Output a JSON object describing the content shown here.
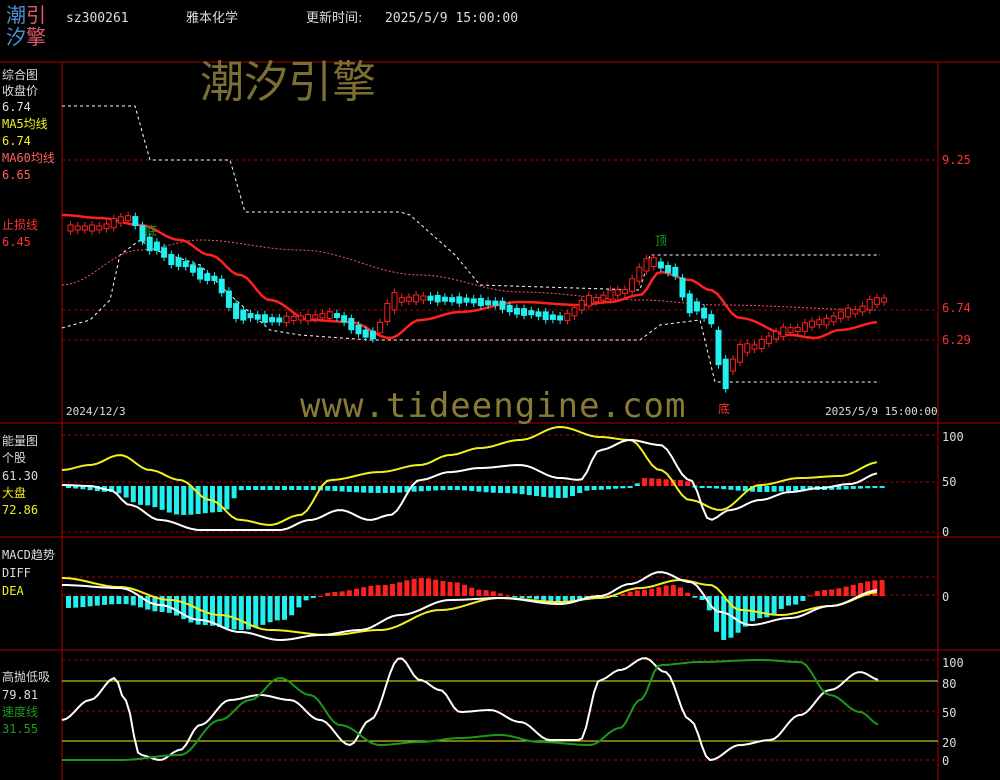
{
  "logo": {
    "line1_a": "潮",
    "line1_b": "引",
    "line2_a": "汐",
    "line2_b": "擎",
    "color_a": "#4a8fd0",
    "color_b": "#e05a6a"
  },
  "header": {
    "code": "sz300261",
    "name": "雅本化学",
    "update_label": "更新时间:",
    "update_time": "2025/5/9 15:00:00"
  },
  "watermarks": {
    "brand": "潮汐引擎",
    "url": "www.tideengine.com"
  },
  "panel_main": {
    "title": "综合图",
    "close_label": "收盘价",
    "close_value": "6.74",
    "ma5_label": "MA5均线",
    "ma5_value": "6.74",
    "ma60_label": "MA60均线",
    "ma60_value": "6.65",
    "stop_label": "止损线",
    "stop_value": "6.45",
    "axis_labels": [
      "9.25",
      "6.74",
      "6.29"
    ],
    "date_start": "2024/12/3",
    "date_end": "2025/5/9  15:00:00",
    "mark_top": "顶",
    "mark_bottom": "底",
    "mark_bottom2": "底"
  },
  "panel_energy": {
    "title": "能量图",
    "stock_label": "个股",
    "stock_value": "61.30",
    "market_label": "大盘",
    "market_value": "72.86",
    "axis_labels": [
      "100",
      "50",
      "0"
    ]
  },
  "panel_macd": {
    "title": "MACD趋势",
    "diff_label": "DIFF",
    "dea_label": "DEA",
    "axis_labels": [
      "0"
    ]
  },
  "panel_hsl": {
    "title": "高抛低吸",
    "value": "79.81",
    "speed_label": "速度线",
    "speed_value": "31.55",
    "axis_labels": [
      "100",
      "80",
      "50",
      "20",
      "0"
    ]
  },
  "colors": {
    "up": "#ff2020",
    "down": "#20f0f0",
    "ma_red": "#ff2020",
    "yellow": "#f0f020",
    "white": "#ffffff",
    "green": "#1a9a1a",
    "grid": "#b00000",
    "pink": "#ff6060"
  }
}
